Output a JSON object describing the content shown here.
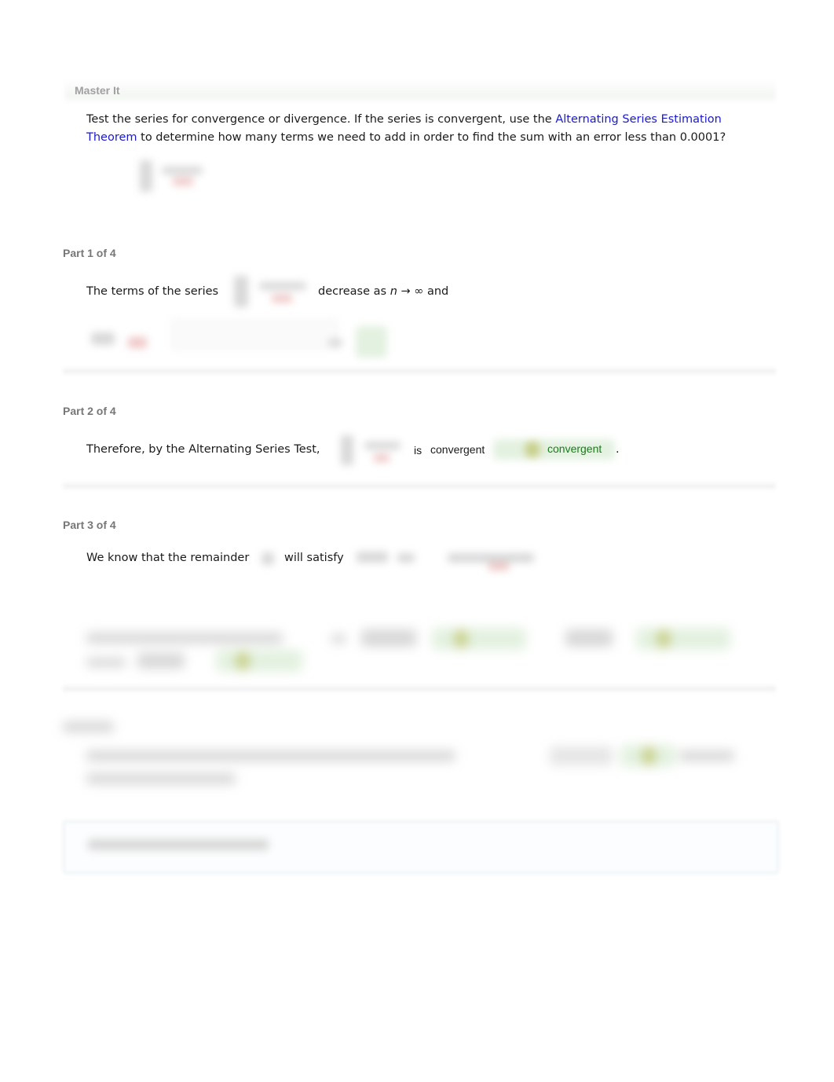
{
  "master": {
    "title": "Master It",
    "intro_before": "Test the series for convergence or divergence. If the series is convergent, use the ",
    "intro_link": "Alternating Series Estimation Theorem",
    "intro_after": " to determine how many terms we need to add in order to find the sum with an error less than 0.0001?"
  },
  "parts": [
    {
      "title": "Part 1 of 4",
      "text_before": "The terms of the series",
      "text_after_pre": "decrease as ",
      "text_var": "n",
      "text_after_post": " → ∞ and"
    },
    {
      "title": "Part 2 of 4",
      "text_before": "Therefore, by the Alternating Series Test,",
      "text_is": "is",
      "answer_value": "convergent",
      "answer_feedback": "convergent",
      "text_end": "."
    },
    {
      "title": "Part 3 of 4",
      "text_before": "We know that the remainder",
      "text_after": "will satisfy"
    }
  ],
  "icons": {
    "check": "check-icon"
  },
  "colors": {
    "link": "#1a1acc",
    "correct": "#1b7a1b",
    "heading": "#777777"
  }
}
